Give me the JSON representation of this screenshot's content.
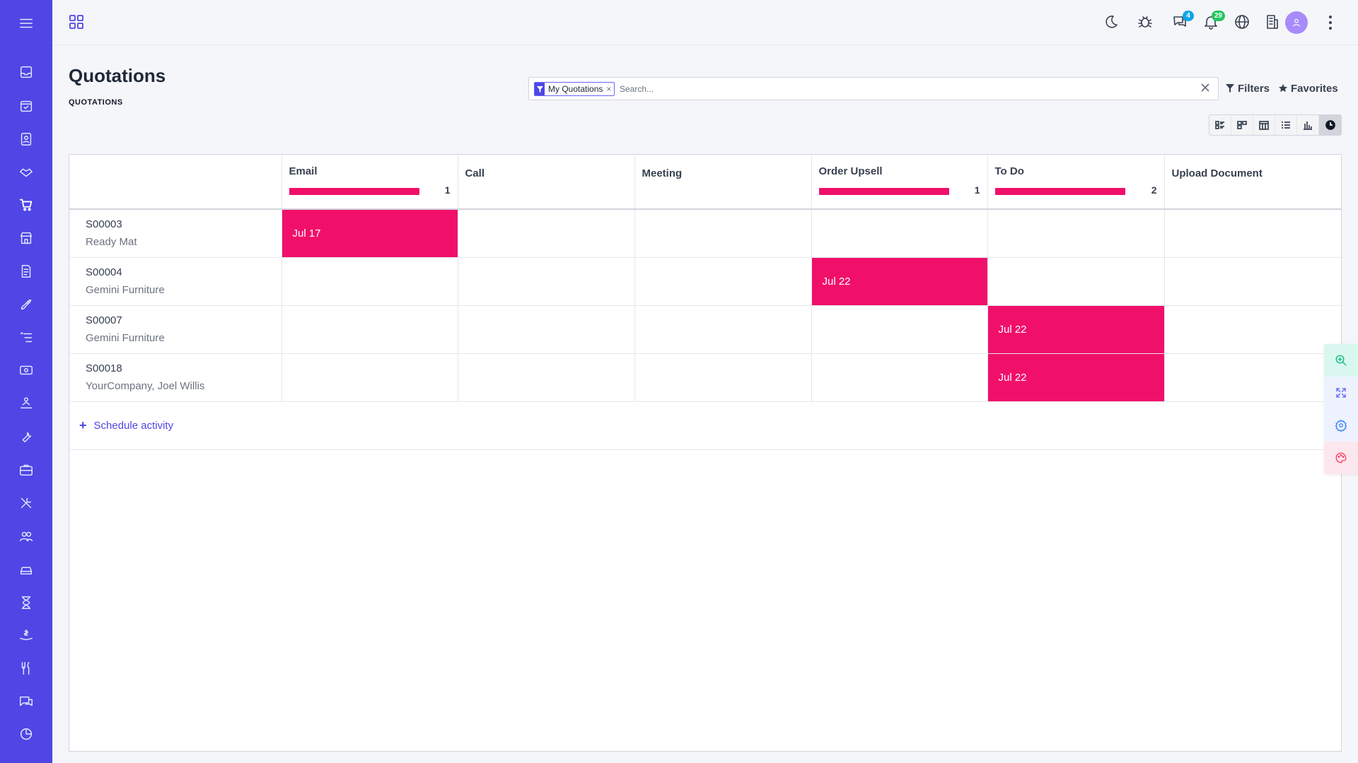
{
  "page": {
    "title": "Quotations",
    "breadcrumb": "QUOTATIONS"
  },
  "sidebar": {
    "menu_icon": "hamburger-icon",
    "items": [
      {
        "icon": "inbox-icon"
      },
      {
        "icon": "calendar-check-icon"
      },
      {
        "icon": "contacts-icon"
      },
      {
        "icon": "handshake-icon"
      },
      {
        "icon": "cart-icon",
        "active": true
      },
      {
        "icon": "store-icon"
      },
      {
        "icon": "invoice-icon"
      },
      {
        "icon": "rocket-icon"
      },
      {
        "icon": "list-icon"
      },
      {
        "icon": "money-icon"
      },
      {
        "icon": "person-desk-icon"
      },
      {
        "icon": "wrench-icon"
      },
      {
        "icon": "briefcase-icon"
      },
      {
        "icon": "tools-icon"
      },
      {
        "icon": "users-icon"
      },
      {
        "icon": "car-icon"
      },
      {
        "icon": "hourglass-icon"
      },
      {
        "icon": "hand-dollar-icon"
      },
      {
        "icon": "utensils-icon"
      },
      {
        "icon": "chat-icon"
      },
      {
        "icon": "pie-chart-icon"
      }
    ]
  },
  "topbar": {
    "icons": [
      {
        "name": "moon-icon"
      },
      {
        "name": "bug-icon"
      },
      {
        "name": "chat-bubbles-icon",
        "badge": "4",
        "badge_color": "#0ea5e9"
      },
      {
        "name": "bell-icon",
        "badge": "29",
        "badge_color": "#22c55e"
      },
      {
        "name": "globe-icon"
      },
      {
        "name": "building-icon"
      }
    ]
  },
  "search": {
    "facet_label": "My Quotations",
    "facet_remove": "×",
    "placeholder": "Search..."
  },
  "controls": {
    "filters_label": "Filters",
    "favorites_label": "Favorites"
  },
  "views": [
    "list",
    "kanban",
    "calendar",
    "list-detail",
    "graph",
    "activity"
  ],
  "activity_grid": {
    "columns": [
      {
        "label": "Email",
        "count": "1",
        "has_bar": true
      },
      {
        "label": "Call",
        "count": "",
        "has_bar": false
      },
      {
        "label": "Meeting",
        "count": "",
        "has_bar": false
      },
      {
        "label": "Order Upsell",
        "count": "1",
        "has_bar": true
      },
      {
        "label": "To Do",
        "count": "2",
        "has_bar": true
      },
      {
        "label": "Upload Document",
        "count": "",
        "has_bar": false
      }
    ],
    "rows": [
      {
        "name": "S00003",
        "partner": "Ready Mat",
        "cells": [
          "Jul 17",
          "",
          "",
          "",
          "",
          ""
        ]
      },
      {
        "name": "S00004",
        "partner": "Gemini Furniture",
        "cells": [
          "",
          "",
          "",
          "Jul 22",
          "",
          ""
        ]
      },
      {
        "name": "S00007",
        "partner": "Gemini Furniture",
        "cells": [
          "",
          "",
          "",
          "",
          "Jul 22",
          ""
        ]
      },
      {
        "name": "S00018",
        "partner": "YourCompany, Joel Willis",
        "cells": [
          "",
          "",
          "",
          "",
          "Jul 22",
          ""
        ]
      }
    ],
    "schedule_label": "Schedule activity",
    "accent_color": "#f0106a"
  },
  "colors": {
    "sidebar": "#4f46e5",
    "accent": "#4f46e5",
    "activity": "#f0106a"
  }
}
